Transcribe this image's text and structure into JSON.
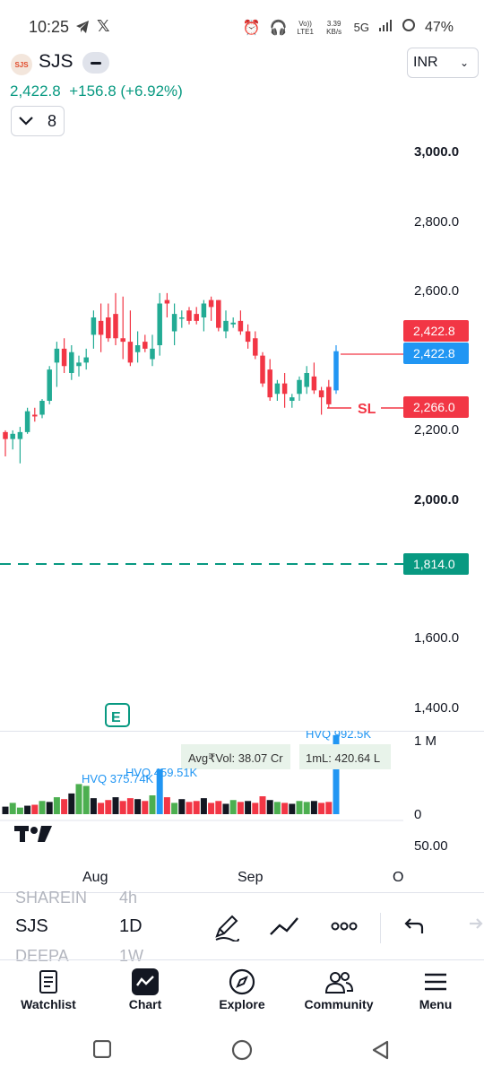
{
  "status_bar": {
    "time": "10:25",
    "volte": "Vo)) LTE1",
    "speed": "3.39 KB/s",
    "network": "5G",
    "battery": "47%"
  },
  "header": {
    "logo_text": "SJS",
    "symbol": "SJS",
    "currency": "INR",
    "last_price": "2,422.8",
    "change": "+156.8 (+6.92%)",
    "indicator_count": "8"
  },
  "price_axis": {
    "labels": [
      "3,000.0",
      "2,800.0",
      "2,600.0",
      "2,200.0",
      "2,000.0",
      "1,600.0",
      "1,400.0"
    ],
    "tags": {
      "high_tag": "2,422.8",
      "last_tag": "2,422.8",
      "stop_loss_tag": "2,266.0",
      "stop_loss_label": "SL",
      "target_tag": "1,814.0"
    }
  },
  "volume_panel": {
    "avg_vol": "Avg₹Vol: 38.07 Cr",
    "ml": "1mL: 420.64 L",
    "hvq_labels": [
      "HVQ 375.74K",
      "HVQ 459.51K",
      "HVQ 992.5K"
    ],
    "axis_top": "1 M",
    "axis_bottom": "0",
    "earnings_marker": "E"
  },
  "oscillator_axis_label": "50.00",
  "date_axis": [
    "Aug",
    "Sep",
    "O"
  ],
  "toolbar": {
    "ghost_symbol_above": "SHAREIN",
    "ghost_interval_above": "4h",
    "symbol": "SJS",
    "interval": "1D",
    "ghost_symbol_below": "DEEPA",
    "ghost_interval_below": "1W"
  },
  "bottom_nav": {
    "items": [
      "Watchlist",
      "Chart",
      "Explore",
      "Community",
      "Menu"
    ]
  },
  "colors": {
    "up": "#22ab94",
    "down": "#f23645",
    "blue": "#2196f3",
    "teal": "#089981"
  },
  "chart_data": {
    "type": "candlestick",
    "title": "",
    "ylim": [
      1400,
      3000
    ],
    "current_price": 2422.8,
    "stop_loss": 2266.0,
    "level_line": 1814.0,
    "candles": [
      {
        "o": 2190,
        "h": 2195,
        "l": 2120,
        "c": 2170
      },
      {
        "o": 2170,
        "h": 2195,
        "l": 2140,
        "c": 2185
      },
      {
        "o": 2170,
        "h": 2205,
        "l": 2100,
        "c": 2190
      },
      {
        "o": 2190,
        "h": 2260,
        "l": 2185,
        "c": 2250
      },
      {
        "o": 2240,
        "h": 2260,
        "l": 2220,
        "c": 2235
      },
      {
        "o": 2240,
        "h": 2285,
        "l": 2230,
        "c": 2280
      },
      {
        "o": 2280,
        "h": 2380,
        "l": 2270,
        "c": 2370
      },
      {
        "o": 2390,
        "h": 2450,
        "l": 2320,
        "c": 2430
      },
      {
        "o": 2430,
        "h": 2460,
        "l": 2360,
        "c": 2380
      },
      {
        "o": 2360,
        "h": 2440,
        "l": 2340,
        "c": 2420
      },
      {
        "o": 2380,
        "h": 2410,
        "l": 2350,
        "c": 2390
      },
      {
        "o": 2390,
        "h": 2430,
        "l": 2370,
        "c": 2405
      },
      {
        "o": 2470,
        "h": 2540,
        "l": 2430,
        "c": 2520
      },
      {
        "o": 2510,
        "h": 2560,
        "l": 2420,
        "c": 2470
      },
      {
        "o": 2520,
        "h": 2560,
        "l": 2450,
        "c": 2460
      },
      {
        "o": 2530,
        "h": 2590,
        "l": 2440,
        "c": 2460
      },
      {
        "o": 2460,
        "h": 2580,
        "l": 2400,
        "c": 2450
      },
      {
        "o": 2450,
        "h": 2540,
        "l": 2380,
        "c": 2390
      },
      {
        "o": 2420,
        "h": 2480,
        "l": 2390,
        "c": 2440
      },
      {
        "o": 2450,
        "h": 2470,
        "l": 2420,
        "c": 2430
      },
      {
        "o": 2400,
        "h": 2470,
        "l": 2380,
        "c": 2430
      },
      {
        "o": 2440,
        "h": 2590,
        "l": 2410,
        "c": 2560
      },
      {
        "o": 2570,
        "h": 2590,
        "l": 2520,
        "c": 2560
      },
      {
        "o": 2480,
        "h": 2560,
        "l": 2440,
        "c": 2530
      },
      {
        "o": 2520,
        "h": 2540,
        "l": 2490,
        "c": 2520
      },
      {
        "o": 2540,
        "h": 2550,
        "l": 2500,
        "c": 2510
      },
      {
        "o": 2530,
        "h": 2550,
        "l": 2500,
        "c": 2510
      },
      {
        "o": 2520,
        "h": 2570,
        "l": 2480,
        "c": 2560
      },
      {
        "o": 2570,
        "h": 2580,
        "l": 2510,
        "c": 2550
      },
      {
        "o": 2570,
        "h": 2570,
        "l": 2480,
        "c": 2490
      },
      {
        "o": 2480,
        "h": 2540,
        "l": 2460,
        "c": 2510
      },
      {
        "o": 2500,
        "h": 2520,
        "l": 2490,
        "c": 2505
      },
      {
        "o": 2510,
        "h": 2540,
        "l": 2470,
        "c": 2480
      },
      {
        "o": 2480,
        "h": 2500,
        "l": 2430,
        "c": 2450
      },
      {
        "o": 2460,
        "h": 2480,
        "l": 2400,
        "c": 2410
      },
      {
        "o": 2410,
        "h": 2420,
        "l": 2320,
        "c": 2330
      },
      {
        "o": 2370,
        "h": 2400,
        "l": 2280,
        "c": 2290
      },
      {
        "o": 2300,
        "h": 2340,
        "l": 2280,
        "c": 2330
      },
      {
        "o": 2330,
        "h": 2360,
        "l": 2260,
        "c": 2300
      },
      {
        "o": 2280,
        "h": 2300,
        "l": 2260,
        "c": 2290
      },
      {
        "o": 2300,
        "h": 2350,
        "l": 2280,
        "c": 2340
      },
      {
        "o": 2320,
        "h": 2380,
        "l": 2300,
        "c": 2360
      },
      {
        "o": 2350,
        "h": 2390,
        "l": 2300,
        "c": 2310
      },
      {
        "o": 2310,
        "h": 2320,
        "l": 2240,
        "c": 2290
      },
      {
        "o": 2320,
        "h": 2340,
        "l": 2260,
        "c": 2270
      },
      {
        "o": 2310,
        "h": 2440,
        "l": 2300,
        "c": 2422.8
      }
    ],
    "volumes": [
      40,
      60,
      35,
      45,
      50,
      70,
      65,
      90,
      80,
      110,
      160,
      150,
      85,
      60,
      75,
      90,
      70,
      85,
      80,
      70,
      100,
      240,
      90,
      60,
      80,
      65,
      70,
      85,
      60,
      70,
      55,
      75,
      65,
      70,
      60,
      95,
      75,
      65,
      60,
      55,
      70,
      65,
      70,
      60,
      65,
      420
    ]
  }
}
